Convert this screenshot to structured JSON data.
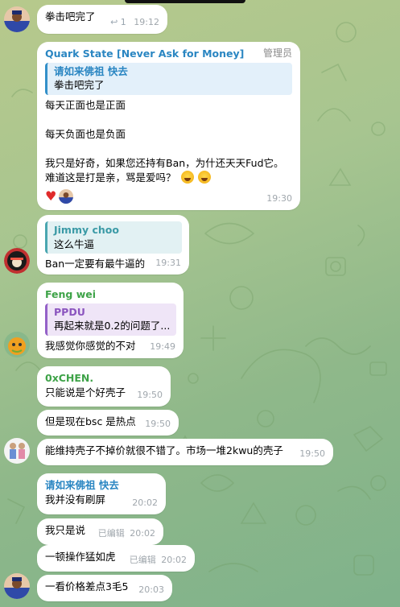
{
  "colors": {
    "quark_name": "#2a86c2",
    "feng_name": "#3ea348",
    "chen_name": "#3ea348",
    "qing_name": "#2a86c2",
    "meta": "#a0a7ad"
  },
  "messages": [
    {
      "id": "m1",
      "text": "拳击吧完了",
      "reply_icon": "reply-arrow-icon",
      "reply_count": "1",
      "time": "19:12"
    },
    {
      "id": "m2",
      "sender": "Quark State [Never Ask for Money]",
      "badge": "管理员",
      "quote": {
        "sender": "请如来佛祖 快去",
        "text": "拳击吧完了"
      },
      "lines": [
        "每天正面也是正面",
        "",
        "每天负面也是负面",
        "",
        "我只是好奇，如果您还持有Ban，为什还天天Fud它。",
        "难道这是打是亲，骂是爱吗？"
      ],
      "emoji": "grinning-sweat-emoji",
      "reactions": [
        "heart-reaction-icon",
        "user-avatar-reaction"
      ],
      "time": "19:30"
    },
    {
      "id": "m3",
      "quote": {
        "sender": "Jimmy choo",
        "text": "这么牛逼"
      },
      "text": "Ban一定要有最牛逼的",
      "time": "19:31"
    },
    {
      "id": "m4",
      "sender": "Feng wei",
      "quote": {
        "sender": "PPDU",
        "text": "再起来就是0.2的问题了..."
      },
      "text": "我感觉你感觉的不对",
      "time": "19:49"
    },
    {
      "id": "m5",
      "sender": "0xCHEN.",
      "text": "只能说是个好壳子",
      "time": "19:50"
    },
    {
      "id": "m6",
      "text": "但是现在bsc 是热点",
      "time": "19:50"
    },
    {
      "id": "m7",
      "text": "能维持壳子不掉价就很不错了。市场一堆2kwu的壳子",
      "time": "19:50"
    },
    {
      "id": "m8",
      "sender": "请如来佛祖 快去",
      "text": "我并没有刷屏",
      "time": "20:02"
    },
    {
      "id": "m9",
      "text": "我只是说",
      "edited": "已编辑",
      "time": "20:02"
    },
    {
      "id": "m10",
      "text": "一顿操作猛如虎",
      "edited": "已编辑",
      "time": "20:02"
    },
    {
      "id": "m11",
      "text": "一看价格差点3毛5",
      "time": "20:03"
    }
  ]
}
